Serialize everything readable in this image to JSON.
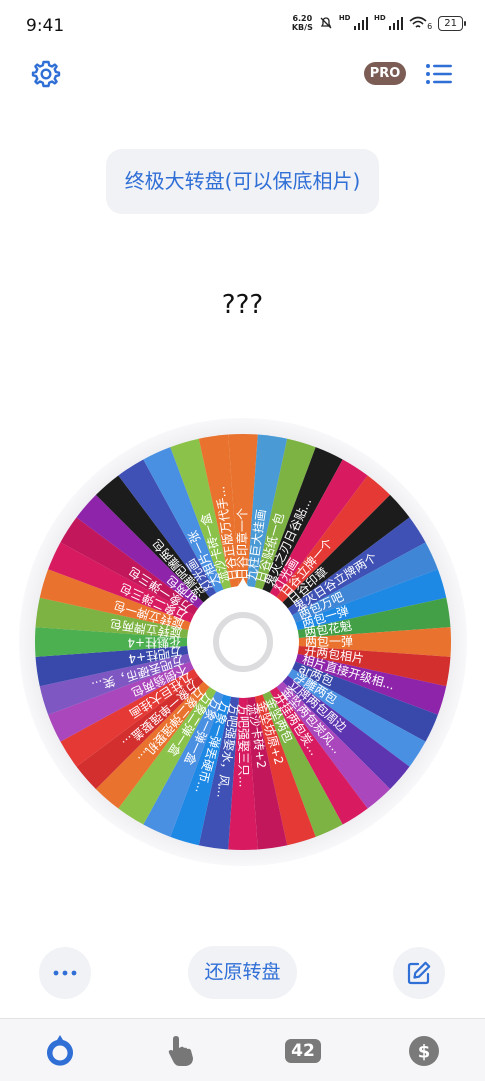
{
  "status": {
    "time": "9:41",
    "net_speed_value": "6.20",
    "net_speed_unit": "KB/S",
    "hd1": "HD",
    "hd2": "HD",
    "wifi_sub": "6",
    "battery": "21"
  },
  "header": {
    "pro_label": "PRO"
  },
  "title": "终极大转盘(可以保底相片)",
  "result": "???",
  "wheel": {
    "segments": [
      {
        "label": "日谷印章一个",
        "color": "#e9732e"
      },
      {
        "label": "九柱巨大挂画",
        "color": "#4a9ad6"
      },
      {
        "label": "日谷贴纸一包",
        "color": "#7cb342"
      },
      {
        "label": "鬼灭之刃日谷贴...",
        "color": "#1c1c1c"
      },
      {
        "label": "灯光画",
        "color": "#d81b60"
      },
      {
        "label": "日谷立牌一个",
        "color": "#e53935"
      },
      {
        "label": "日谷印章",
        "color": "#1c1c1c"
      },
      {
        "label": "鬼灭日谷立牌两个",
        "color": "#3f51b5"
      },
      {
        "label": "两包万吧",
        "color": "#3f86d6"
      },
      {
        "label": "两包一弹",
        "color": "#1e88e5"
      },
      {
        "label": "两包花魁",
        "color": "#43a047"
      },
      {
        "label": "两包一弹",
        "color": "#e9732e"
      },
      {
        "label": "开两包相片",
        "color": "#d32f2f"
      },
      {
        "label": "相片直接开级相...",
        "color": "#8e24aa"
      },
      {
        "label": "ar两包",
        "color": "#3949ab"
      },
      {
        "label": "浮雕两包",
        "color": "#4a90e2"
      },
      {
        "label": "立牌两包周边",
        "color": "#5e35b1"
      },
      {
        "label": "金坠两包炭风...",
        "color": "#ab47bc"
      },
      {
        "label": "开挂两包炭...",
        "color": "#d81b60"
      },
      {
        "label": "金坠两包",
        "color": "#7cb342"
      },
      {
        "label": "金坠坊原+2",
        "color": "#e53935"
      },
      {
        "label": "流沙卡砖+2",
        "color": "#c2185b"
      },
      {
        "label": "方吧强娶三只...",
        "color": "#d81b60"
      },
      {
        "label": "方吧强娶水，风...",
        "color": "#3f51b5"
      },
      {
        "label": "万象一弹丢硬币...",
        "color": "#1e88e5"
      },
      {
        "label": "万象一弹一盒",
        "color": "#4a90e2"
      },
      {
        "label": "万象二弹一盒",
        "color": "#8bc34a"
      },
      {
        "label": "万象二弹强娶机...",
        "color": "#e9732e"
      },
      {
        "label": "万象一单强娶盖...",
        "color": "#d32f2f"
      },
      {
        "label": "九柱巨大挂画",
        "color": "#e53935"
      },
      {
        "label": "不倒翁两包",
        "color": "#ab47bc"
      },
      {
        "label": "方吧丢硬币，笑...",
        "color": "#7e57c2"
      },
      {
        "label": "方吧柱+4",
        "color": "#3949ab"
      },
      {
        "label": "花魁柱+4",
        "color": "#4caf50"
      },
      {
        "label": "旋转立牌两包",
        "color": "#7cb342"
      },
      {
        "label": "旋转立牌一包",
        "color": "#e9732e"
      },
      {
        "label": "万象二弹三包",
        "color": "#d81b60"
      },
      {
        "label": "万象一弹三包",
        "color": "#c2185b"
      },
      {
        "label": "ar两包",
        "color": "#8e24aa"
      },
      {
        "label": "浮雕吧雕两包",
        "color": "#1c1c1c"
      },
      {
        "label": "灯光画",
        "color": "#3f51b5"
      },
      {
        "label": "大相片一张",
        "color": "#4a90e2"
      },
      {
        "label": "流沙卡砖一盒",
        "color": "#8bc34a"
      },
      {
        "label": "日谷正版万代手...",
        "color": "#e9732e"
      }
    ]
  },
  "actions": {
    "reset_label": "还原转盘"
  },
  "tabs": {
    "count": "42"
  },
  "colors": {
    "accent": "#2f6fd6",
    "pill_bg": "#f1f2f6",
    "pro": "#7b5d55"
  },
  "icons": [
    "gear-icon",
    "list-icon",
    "more-dots-icon",
    "edit-icon",
    "wheel-tab-icon",
    "hand-pointer-icon",
    "dollar-icon"
  ]
}
